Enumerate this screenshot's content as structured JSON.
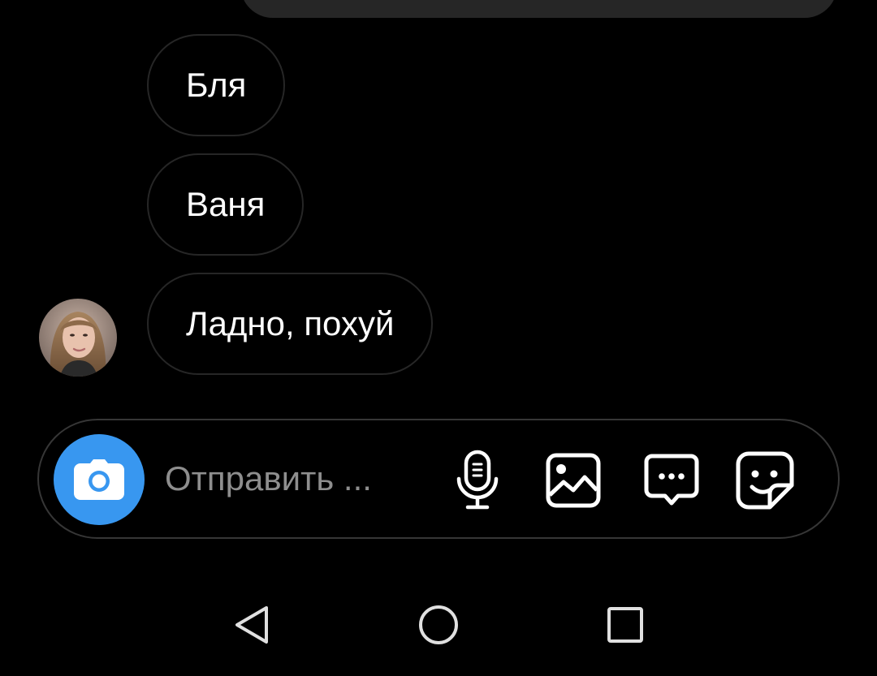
{
  "messages": [
    {
      "text": "Бля"
    },
    {
      "text": "Ваня"
    },
    {
      "text": "Ладно, похуй"
    }
  ],
  "composer": {
    "placeholder": "Отправить ...",
    "icons": [
      "camera-icon",
      "microphone-icon",
      "gallery-icon",
      "chat-bubble-icon",
      "sticker-icon"
    ]
  },
  "navbar": {
    "icons": [
      "back-icon",
      "home-icon",
      "recent-apps-icon"
    ]
  },
  "colors": {
    "background": "#000000",
    "bubble_border": "#262626",
    "accent": "#3897f0",
    "placeholder": "#8e8e8e"
  }
}
